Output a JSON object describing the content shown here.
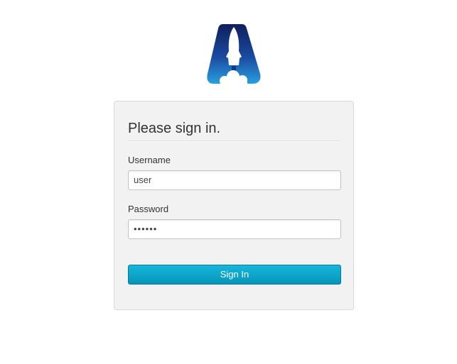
{
  "logo": {
    "icon": "rocket-logo-icon",
    "colors": [
      "#0f1f5c",
      "#2a9fe0"
    ]
  },
  "form": {
    "title": "Please sign in.",
    "username_label": "Username",
    "username_value": "user",
    "password_label": "Password",
    "password_value": "••••••",
    "submit_label": "Sign In"
  },
  "colors": {
    "button": "#0aa0c8",
    "card_background": "#f2f2f2"
  }
}
